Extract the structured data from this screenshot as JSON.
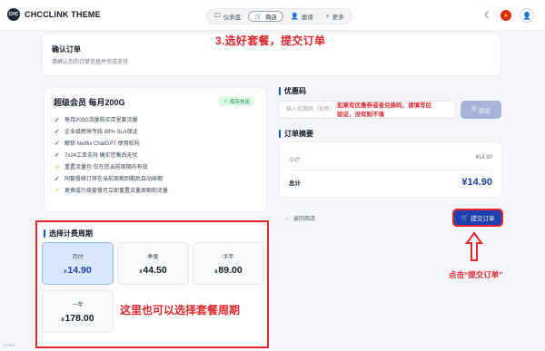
{
  "app": {
    "title": "CHCCLINK THEME",
    "logo_mark": "CHC"
  },
  "nav": [
    {
      "icon": "monitor-icon",
      "glyph": "🖵",
      "label": "仪表盘"
    },
    {
      "icon": "shop-icon",
      "glyph": "🛒",
      "label": "商店"
    },
    {
      "icon": "invite-icon",
      "glyph": "👤",
      "label": "邀请"
    },
    {
      "icon": "plus-icon",
      "glyph": "+",
      "label": "更多"
    }
  ],
  "annotations": {
    "top": "3.选好套餐，提交订单",
    "coupon": "如果有优惠券或者兑换码，请填写后验证，没有则不填",
    "period": "这里也可以选择套餐周期",
    "submit": "点击“提交订单”"
  },
  "header": {
    "title": "确认订单",
    "subtitle": "请确认您的订单信息并完成支付"
  },
  "plan": {
    "title": "超级会员 每月200G",
    "stock_label": "库存充足",
    "features": [
      {
        "icon": "check",
        "text": "每月200G流量购买百里套流量"
      },
      {
        "icon": "check",
        "text": "企业级跨境专线 99% SLA保证"
      },
      {
        "icon": "check",
        "text": "解锁 Netflix ChatGPT 使用权利"
      },
      {
        "icon": "check",
        "text": "7x24工单支持 确实您售后无忧"
      },
      {
        "icon": "warning",
        "text": "重置流量包 仅在您当前周期内有效"
      },
      {
        "icon": "check",
        "text": "同套餐续订将在当前周期到期后自动续期"
      },
      {
        "icon": "bolt",
        "text": "更换或升级套餐可立即重置流量周期和流量"
      }
    ]
  },
  "coupon": {
    "section_title": "优惠码",
    "placeholder": "输入优惠码（如有）",
    "verify_label": "验证"
  },
  "summary": {
    "section_title": "订单摘要",
    "subtotal_label": "小计",
    "subtotal_value": "¥14.90",
    "total_label": "总计",
    "total_value": "¥14.90"
  },
  "actions": {
    "back_label": "返回商店",
    "submit_label": "提交订单"
  },
  "period": {
    "section_title": "选择计费周期",
    "options": [
      {
        "name": "月付",
        "currency": "¥",
        "price": "14.90",
        "selected": true
      },
      {
        "name": "季度",
        "currency": "¥",
        "price": "44.50",
        "selected": false
      },
      {
        "name": "半年",
        "currency": "¥",
        "price": "89.00",
        "selected": false
      },
      {
        "name": "一年",
        "currency": "¥",
        "price": "178.00",
        "selected": false
      }
    ]
  },
  "footer": {
    "version": "v1.0.0"
  },
  "colors": {
    "accent": "#1e40af",
    "annotation": "#e4262c",
    "selected_bg": "#dbe7fb",
    "stock_bg": "#dcfce7"
  }
}
